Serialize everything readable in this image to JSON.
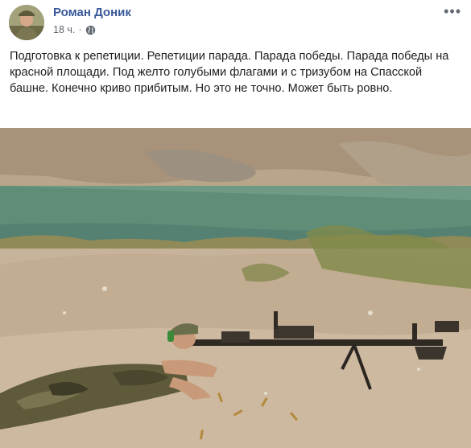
{
  "post": {
    "author": "Роман Доник",
    "time": "18 ч.",
    "dot": "·",
    "more_icon": "more-dots-icon",
    "privacy_icon": "globe-icon",
    "text": "Подготовка к репетиции. Репетиции парада. Парада победы. Парада победы на красной площади. Под желто голубыми флагами и с тризубом на Спасской башне. Конечно криво прибитым. Но это не точно. Может быть ровно."
  },
  "colors": {
    "author_link": "#385898",
    "meta_text": "#606770",
    "body_text": "#1c1e21"
  }
}
